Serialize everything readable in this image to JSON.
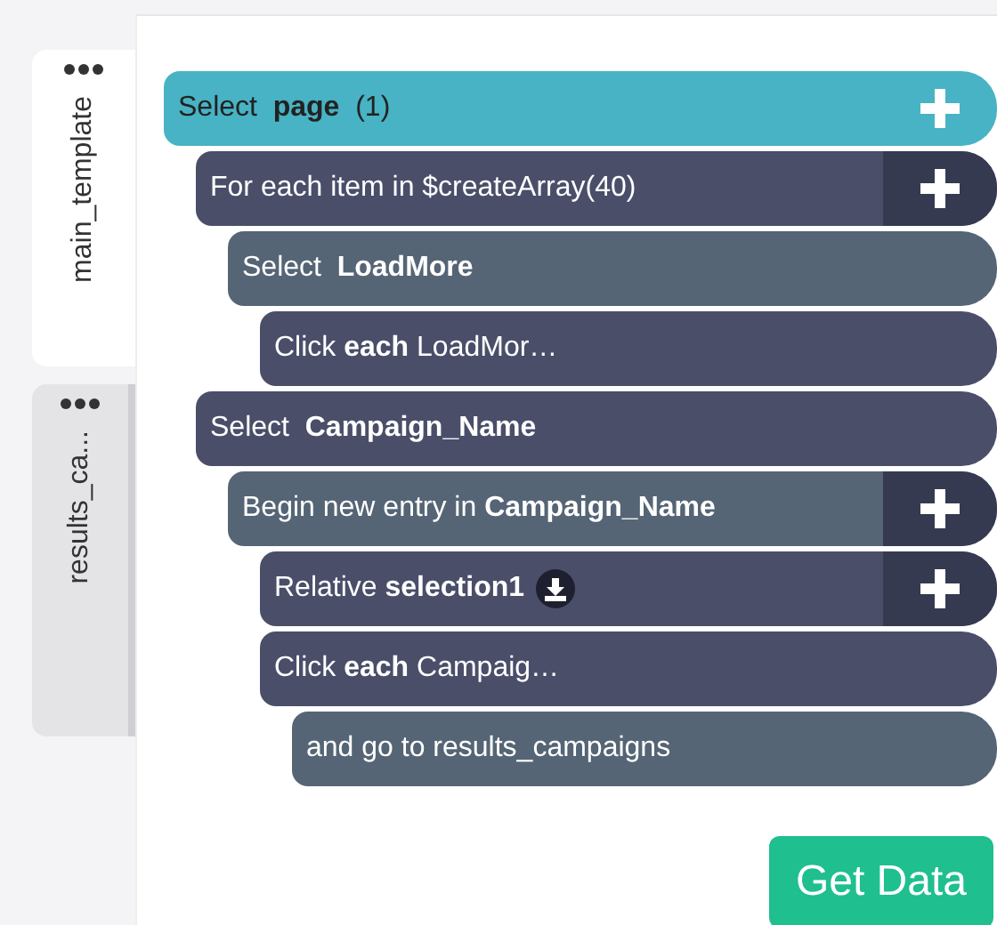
{
  "tabs": [
    {
      "label": "main_template",
      "selected": true
    },
    {
      "label": "results_ca...",
      "selected": false
    }
  ],
  "steps": [
    {
      "kind": "root",
      "color": "#47b3c4",
      "text": "Select  **page**  (1)",
      "add_button": true,
      "children": [
        {
          "kind": "step",
          "color": "#4a4e69",
          "text": "For each item in $createArray(40)",
          "add_button": true,
          "children": [
            {
              "kind": "step",
              "color": "#556575",
              "text": "Select  **LoadMore**",
              "children": [
                {
                  "kind": "step",
                  "color": "#4a4e69",
                  "text": "Click **each** LoadMor…"
                }
              ]
            }
          ]
        },
        {
          "kind": "step",
          "color": "#4a4e69",
          "text": "Select  **Campaign_Name**",
          "children": [
            {
              "kind": "step",
              "color": "#556575",
              "text": "Begin new entry in **Campaign_Name**",
              "add_button": true,
              "children": [
                {
                  "kind": "step",
                  "color": "#4a4e69",
                  "text": "Relative **selection1**",
                  "download_icon": true,
                  "add_button": true
                },
                {
                  "kind": "step",
                  "color": "#4a4e69",
                  "text": "Click **each** Campaig…",
                  "children": [
                    {
                      "kind": "step",
                      "color": "#556575",
                      "text": "and go to results_campaigns"
                    }
                  ]
                }
              ]
            }
          ]
        }
      ]
    }
  ],
  "get_data_button": "Get Data"
}
